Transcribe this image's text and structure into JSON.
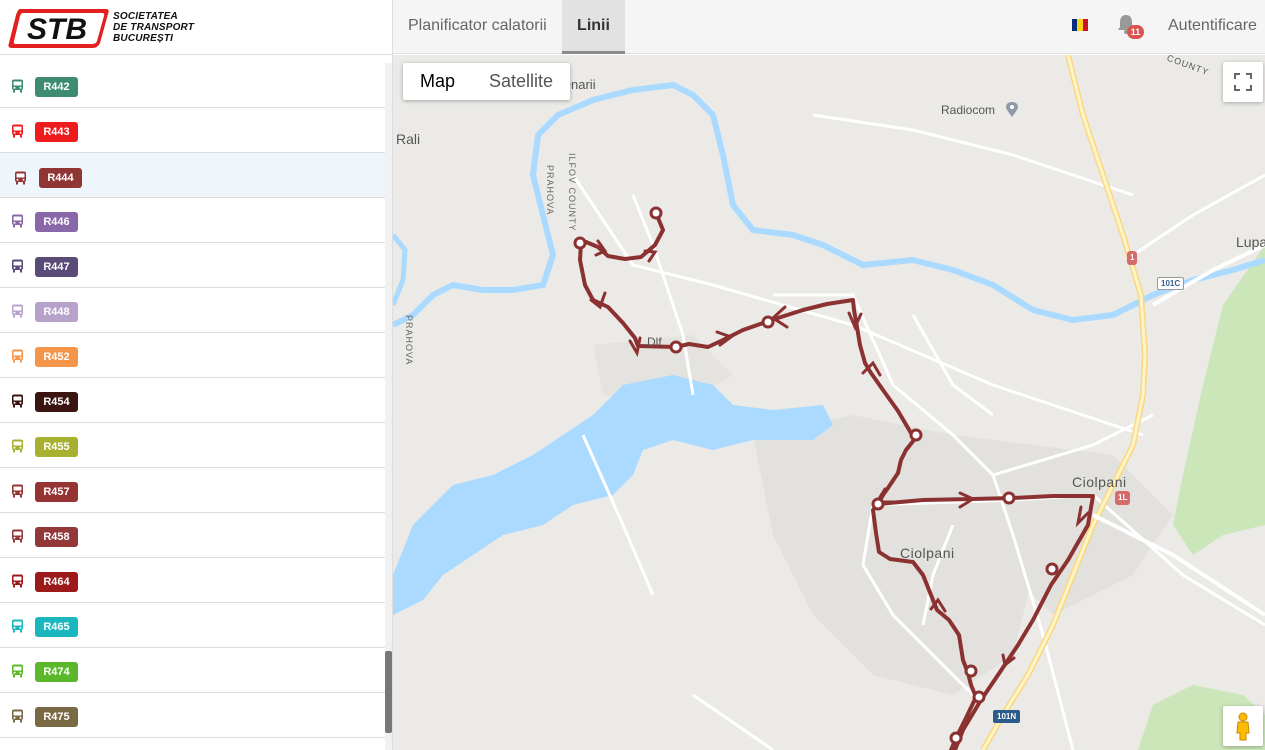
{
  "brand": {
    "logo_text": "STB",
    "name_lines": [
      "SOCIETATEA",
      "DE TRANSPORT",
      "BUCUREȘTI"
    ]
  },
  "routes": [
    {
      "label": "R442",
      "color": "#3d8c70",
      "selected": false
    },
    {
      "label": "R443",
      "color": "#ee1c1c",
      "selected": false
    },
    {
      "label": "R444",
      "color": "#913434",
      "selected": true
    },
    {
      "label": "R446",
      "color": "#8a67a8",
      "selected": false
    },
    {
      "label": "R447",
      "color": "#5a4a78",
      "selected": false
    },
    {
      "label": "R448",
      "color": "#b7a2cc",
      "selected": false
    },
    {
      "label": "R452",
      "color": "#f5954a",
      "selected": false
    },
    {
      "label": "R454",
      "color": "#3a1410",
      "selected": false
    },
    {
      "label": "R455",
      "color": "#a8b030",
      "selected": false
    },
    {
      "label": "R457",
      "color": "#963434",
      "selected": false
    },
    {
      "label": "R458",
      "color": "#923838",
      "selected": false
    },
    {
      "label": "R464",
      "color": "#9c1a1a",
      "selected": false
    },
    {
      "label": "R465",
      "color": "#1ab7bf",
      "selected": false
    },
    {
      "label": "R474",
      "color": "#5ab82a",
      "selected": false
    },
    {
      "label": "R475",
      "color": "#7a6a44",
      "selected": false
    }
  ],
  "nav": {
    "planner": "Planificator calatorii",
    "lines": "Linii",
    "login": "Autentificare",
    "notifications": "11",
    "flag_colors": [
      "#002b7f",
      "#fcd116",
      "#ce1126"
    ]
  },
  "map": {
    "map_button": "Map",
    "satellite_button": "Satellite",
    "route_color": "#8b3131",
    "labels": {
      "bojenarii": "Bojenarii",
      "rali": "Rali",
      "radiocom": "Radiocom",
      "county": "COUNTY",
      "ilfov_county": "ILFOV COUNTY",
      "prahova_1": "PRAHOVA",
      "prahova_2": "PRAHOVA",
      "lupa": "Lupa",
      "ciolpani_town": "Ciolpani",
      "ciolpani_commune": "Ciolpani",
      "dlf": "Dlf"
    },
    "shields": {
      "r1": "1",
      "r101c": "101C",
      "r1l": "1L",
      "r101n": "101N"
    }
  }
}
